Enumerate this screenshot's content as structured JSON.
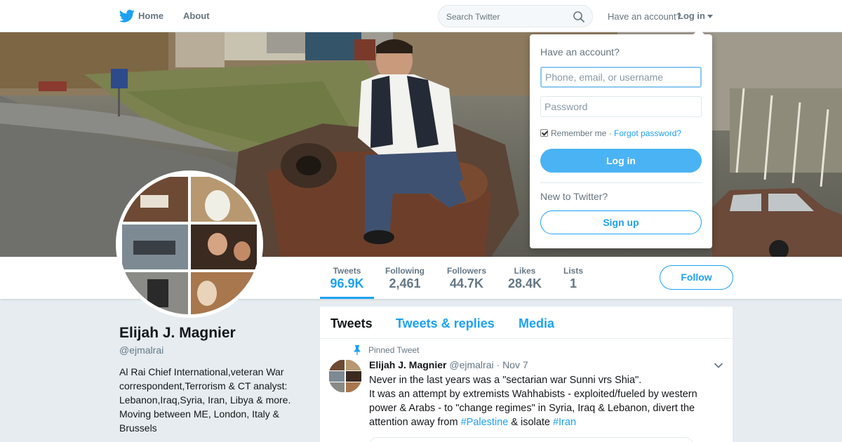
{
  "nav": {
    "logo_icon": "twitter-bird-icon",
    "home_label": "Home",
    "about_label": "About",
    "search_placeholder": "Search Twitter",
    "have_account_label": "Have an account?",
    "login_label": "Log in"
  },
  "profile": {
    "name": "Elijah J. Magnier",
    "handle": "@ejmalrai",
    "bio": "Al Rai Chief International,veteran War correspondent,Terrorism & CT analyst: Lebanon,Iraq,Syria, Iran, Libya & more. Moving between ME, London, Italy & Brussels"
  },
  "stats": [
    {
      "label": "Tweets",
      "value": "96.9K",
      "active": true
    },
    {
      "label": "Following",
      "value": "2,461",
      "active": false
    },
    {
      "label": "Followers",
      "value": "44.7K",
      "active": false
    },
    {
      "label": "Likes",
      "value": "28.4K",
      "active": false
    },
    {
      "label": "Lists",
      "value": "1",
      "active": false
    }
  ],
  "follow_label": "Follow",
  "timeline": {
    "tabs": [
      "Tweets",
      "Tweets & replies",
      "Media"
    ],
    "active_tab": "Tweets"
  },
  "pinned_tweet": {
    "pinned_label": "Pinned Tweet",
    "author_name": "Elijah J. Magnier",
    "author_handle": "@ejmalrai",
    "separator": "·",
    "date": "Nov 7",
    "line1": "Never in the last years was a \"sectarian war Sunni vrs Shia\".",
    "line2_pre": "It was an attempt by extremists Wahhabists - exploited/fueled by western power & Arabs - to \"change regimes\" in Syria, Iraq & Lebanon, divert the attention away from ",
    "hashtag1": "#Palestine",
    "line2_mid": " & isolate ",
    "hashtag2": "#Iran"
  },
  "login_dropdown": {
    "title": "Have an account?",
    "username_placeholder": "Phone, email, or username",
    "password_placeholder": "Password",
    "remember_label": "Remember me",
    "separator": " · ",
    "forgot_label": "Forgot password?",
    "login_button": "Log in",
    "new_label": "New to Twitter?",
    "signup_button": "Sign up"
  },
  "colors": {
    "accent": "#1da1f2",
    "login_button": "#4ab3f4",
    "text_muted": "#657786",
    "background": "#e6ecf0"
  }
}
